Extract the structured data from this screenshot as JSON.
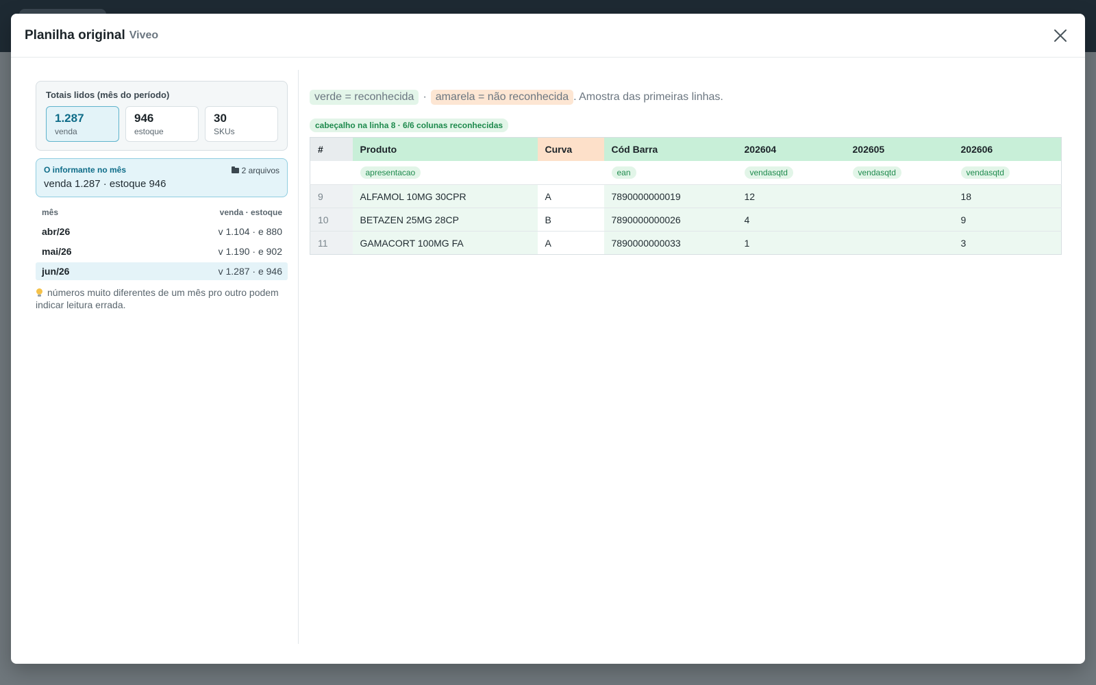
{
  "modal": {
    "title": "Planilha original",
    "subtitle": "Viveo"
  },
  "totals": {
    "title": "Totais lidos (mês do período)",
    "boxes": [
      {
        "value": "1.287",
        "label": "venda"
      },
      {
        "value": "946",
        "label": "estoque"
      },
      {
        "value": "30",
        "label": "SKUs"
      }
    ]
  },
  "informant": {
    "title": "O informante no mês",
    "files": "2 arquivos",
    "summary": "venda 1.287 · estoque 946"
  },
  "months": {
    "header_month": "mês",
    "header_values": "venda · estoque",
    "rows": [
      {
        "month": "abr/26",
        "values": "v 1.104 · e 880"
      },
      {
        "month": "mai/26",
        "values": "v 1.190 · e 902"
      },
      {
        "month": "jun/26",
        "values": "v 1.287 · e 946"
      }
    ]
  },
  "hint": "números muito diferentes de um mês pro outro podem indicar leitura errada.",
  "legend": {
    "green": "verde = reconhecida",
    "sep": "·",
    "orange": "amarela = não reconhecida",
    "rest": ". Amostra das primeiras linhas."
  },
  "header_badge": "cabeçalho na linha 8 · 6/6 colunas reconhecidas",
  "grid": {
    "columns": [
      "#",
      "Produto",
      "Curva",
      "Cód Barra",
      "202604",
      "202605",
      "202606"
    ],
    "mappings": [
      "",
      "apresentacao",
      "",
      "ean",
      "vendasqtd",
      "vendasqtd",
      "vendasqtd"
    ],
    "rows": [
      [
        "9",
        "ALFAMOL 10MG 30CPR",
        "A",
        "7890000000019",
        "12",
        "",
        "18"
      ],
      [
        "10",
        "BETAZEN 25MG 28CP",
        "B",
        "7890000000026",
        "4",
        "",
        "9"
      ],
      [
        "11",
        "GAMACORT 100MG FA",
        "A",
        "7890000000033",
        "1",
        "",
        "3"
      ]
    ]
  },
  "colors": {
    "accent": "#0e6c88",
    "recognized": "#c8efd8",
    "unrecognized": "#fde0c9"
  },
  "icons": {
    "close": "close-icon",
    "folder": "folder-icon",
    "bulb": "lightbulb-icon"
  }
}
